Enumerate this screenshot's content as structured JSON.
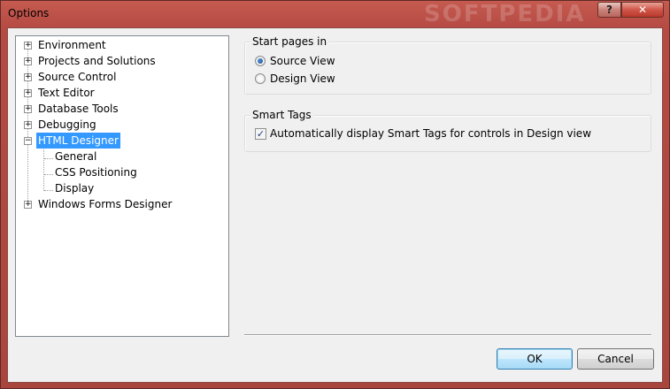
{
  "window": {
    "title": "Options",
    "watermark": "SOFTPEDIA",
    "help_label": "?",
    "close_label": "✕"
  },
  "tree": {
    "items": [
      {
        "label": "Environment",
        "expander": "+"
      },
      {
        "label": "Projects and Solutions",
        "expander": "+"
      },
      {
        "label": "Source Control",
        "expander": "+"
      },
      {
        "label": "Text Editor",
        "expander": "+"
      },
      {
        "label": "Database Tools",
        "expander": "+"
      },
      {
        "label": "Debugging",
        "expander": "+"
      },
      {
        "label": "HTML Designer",
        "expander": "−",
        "selected": true,
        "children": [
          "General",
          "CSS Positioning",
          "Display"
        ]
      },
      {
        "label": "Windows Forms Designer",
        "expander": "+"
      }
    ]
  },
  "start_pages": {
    "title": "Start pages in",
    "options": [
      {
        "label": "Source View",
        "checked": true
      },
      {
        "label": "Design View",
        "checked": false
      }
    ]
  },
  "smart_tags": {
    "title": "Smart Tags",
    "checkbox_label": "Automatically display Smart Tags for controls in Design view",
    "checked": true
  },
  "buttons": {
    "ok": "OK",
    "cancel": "Cancel"
  },
  "colors": {
    "selection": "#3399ff",
    "titlebar": "#b54b43",
    "close": "#d0574a"
  }
}
